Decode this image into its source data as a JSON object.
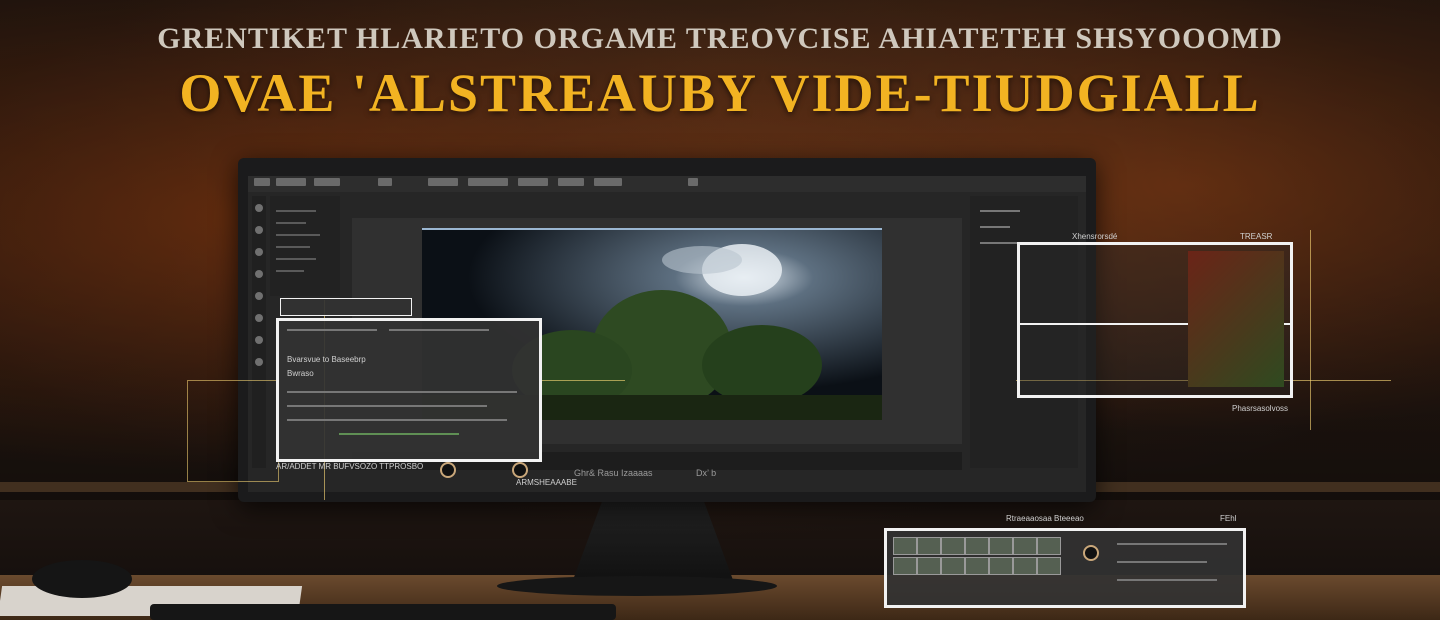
{
  "headline": {
    "line1": "GRENTIKET HLARIETO ORGAME TREOVCISE AHIATETEH SHSYOOOMD",
    "line2": "OVAE 'ALSTREAUBY VIDE-TIUDGIALL"
  },
  "editor": {
    "status_text": "Ghr& Rasu Izaaaas",
    "timecode_text": "Dx’ b",
    "bottom_label": "AR/ADDET MR BUFVSOZO TTPROSBO",
    "mini_label": "ARMSHEAAABE",
    "right_panel_title": "Xhensrorsdé",
    "right_panel_title2": "TREASR",
    "right_panel_footer": "Phasrsasolvoss",
    "bottom_right_title": "Rtraeaaosaa Bteeeao",
    "bottom_right_sub": "FEhl",
    "left_panel_title": "Bvarsvue to Baseebrp",
    "left_panel_sub": "Bwraso"
  },
  "icons": {
    "play": "play-icon",
    "knob": "knob-icon"
  },
  "colors": {
    "headline_gold": "#f2b322",
    "panel_border": "#f2f2f2",
    "annotation": "#ffdc78"
  }
}
